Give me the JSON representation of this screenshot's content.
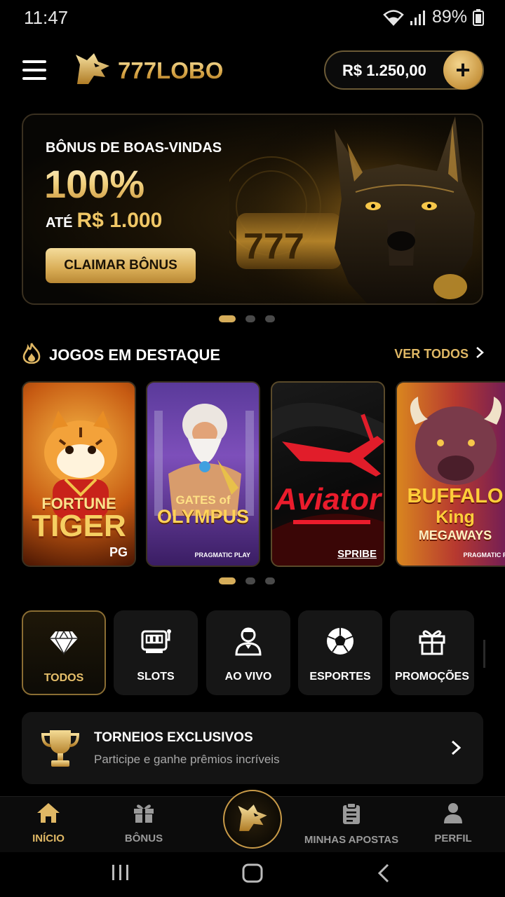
{
  "status_bar": {
    "time": "11:47",
    "battery": "89%"
  },
  "header": {
    "brand": "777LOBO",
    "balance": "R$ 1.250,00",
    "add_symbol": "+"
  },
  "banner": {
    "kicker": "BÔNUS DE BOAS-VINDAS",
    "percent": "100%",
    "upto_prefix": "ATÉ",
    "upto_amount": "R$ 1.000",
    "cta": "CLAIMAR BÔNUS",
    "slot_digits": "777",
    "active_slide": 1,
    "slides": 3
  },
  "featured": {
    "title": "JOGOS EM DESTAQUE",
    "see_all": "VER TODOS",
    "games": [
      {
        "line1": "FORTUNE",
        "line2": "TIGER",
        "provider": "PG"
      },
      {
        "line1": "GATES of",
        "line2": "OLYMPUS",
        "provider": "PRAGMATIC PLAY"
      },
      {
        "line1": "Aviator",
        "line2": "",
        "provider": "SPRIBE"
      },
      {
        "line1": "BUFFALO",
        "line2": "King",
        "line3": "MEGAWAYS",
        "provider": "PRAGMATIC PLAY"
      }
    ],
    "active_slide": 1,
    "slides": 3
  },
  "categories": [
    {
      "label": "TODOS",
      "icon": "diamond-icon",
      "active": true
    },
    {
      "label": "SLOTS",
      "icon": "slot-machine-icon",
      "active": false
    },
    {
      "label": "AO VIVO",
      "icon": "dealer-icon",
      "active": false
    },
    {
      "label": "ESPORTES",
      "icon": "soccer-ball-icon",
      "active": false
    },
    {
      "label": "PROMOÇÕES",
      "icon": "gift-icon",
      "active": false
    }
  ],
  "tournament": {
    "title": "TORNEIOS EXCLUSIVOS",
    "subtitle": "Participe e ganhe prêmios incríveis"
  },
  "bottom_nav": [
    {
      "label": "INÍCIO",
      "icon": "home-icon",
      "active": true
    },
    {
      "label": "BÔNUS",
      "icon": "gift-icon",
      "active": false
    },
    {
      "label": "MINHAS APOSTAS",
      "icon": "clipboard-icon",
      "active": false
    },
    {
      "label": "PERFIL",
      "icon": "user-icon",
      "active": false
    }
  ],
  "colors": {
    "accent": "#d6ad5a",
    "background": "#000000",
    "card": "#161616"
  }
}
